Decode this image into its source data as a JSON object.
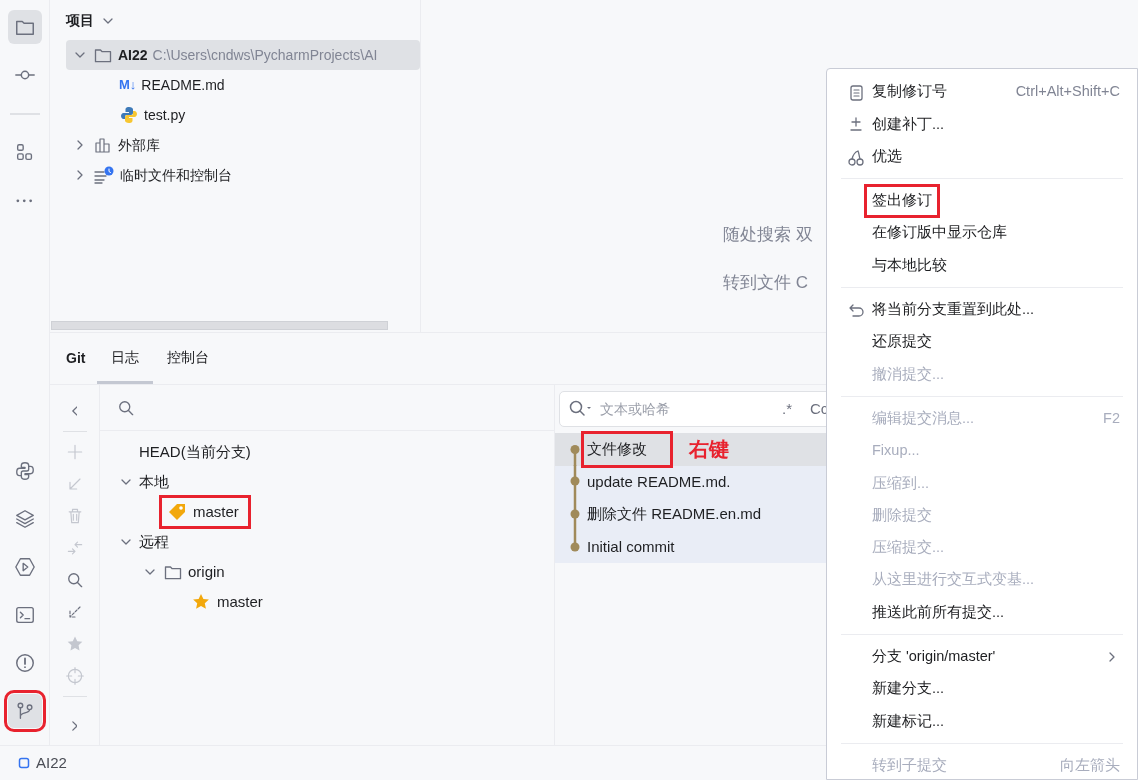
{
  "tool_window_bar": {
    "top": [
      {
        "kind": "folder",
        "selected": true
      },
      {
        "kind": "commit",
        "selected": false
      },
      {
        "kind": "separator"
      },
      {
        "kind": "structure",
        "selected": false
      },
      {
        "kind": "more",
        "selected": false
      }
    ],
    "bottom": [
      {
        "kind": "python",
        "selected": false
      },
      {
        "kind": "layers",
        "selected": false
      },
      {
        "kind": "run",
        "selected": false
      },
      {
        "kind": "terminal",
        "selected": false
      },
      {
        "kind": "problems",
        "selected": false
      },
      {
        "kind": "git",
        "selected": true,
        "annotated": true
      }
    ]
  },
  "project": {
    "title": "项目",
    "tree": [
      {
        "kind": "project",
        "label": "AI22",
        "path": "C:\\Users\\cndws\\PycharmProjects\\AI",
        "expanded": true,
        "selected": true,
        "children": [
          {
            "kind": "markdown",
            "icon_text": "M↓",
            "label": "README.md",
            "selected": false
          },
          {
            "kind": "python",
            "label": "test.py",
            "selected": false
          }
        ]
      },
      {
        "kind": "library",
        "label": "外部库",
        "expanded": false,
        "selected": false
      },
      {
        "kind": "scratches",
        "label": "临时文件和控制台",
        "expanded": false,
        "selected": false
      }
    ]
  },
  "editor": {
    "hints": [
      "随处搜索 双",
      "转到文件 C"
    ]
  },
  "git": {
    "title": "Git",
    "tabs": [
      {
        "label": "日志",
        "selected": true
      },
      {
        "label": "控制台",
        "selected": false
      }
    ],
    "toolbar": [
      {
        "kind": "collapse",
        "disabled": false
      },
      {
        "kind": "separator"
      },
      {
        "kind": "add",
        "disabled": true
      },
      {
        "kind": "checkout",
        "disabled": true
      },
      {
        "kind": "delete",
        "disabled": true
      },
      {
        "kind": "merge",
        "disabled": true
      },
      {
        "kind": "search",
        "disabled": false
      },
      {
        "kind": "fetch",
        "disabled": false
      },
      {
        "kind": "favorite",
        "disabled": true
      },
      {
        "kind": "locate",
        "disabled": true
      },
      {
        "kind": "separator"
      },
      {
        "kind": "expand",
        "disabled": false
      }
    ],
    "branches": [
      {
        "label": "HEAD(当前分支)"
      },
      {
        "label": "本地",
        "expanded": true,
        "children": [
          {
            "kind": "local_branch",
            "label": "master",
            "annotated": true
          }
        ]
      },
      {
        "label": "远程",
        "expanded": true,
        "children": [
          {
            "kind": "remote",
            "label": "origin",
            "expanded": true,
            "children": [
              {
                "kind": "remote_branch",
                "label": "master",
                "annotated": false
              }
            ]
          }
        ]
      }
    ],
    "log": {
      "search": {
        "placeholder": "文本或哈希",
        "regex": ".*",
        "case": "Cc"
      },
      "annotation_label": "右键",
      "commits": [
        {
          "message": "文件修改",
          "selected": true,
          "annotated": true
        },
        {
          "message": "update README.md.",
          "selected": false,
          "annotated": false
        },
        {
          "message": "删除文件 README.en.md",
          "selected": false,
          "annotated": false
        },
        {
          "message": "Initial commit",
          "selected": false,
          "annotated": false
        }
      ]
    }
  },
  "context_menu": {
    "items": [
      {
        "kind": "copy",
        "label": "复制修订号",
        "shortcut": "Ctrl+Alt+Shift+C",
        "disabled": false
      },
      {
        "kind": "patch",
        "label": "创建补丁...",
        "disabled": false
      },
      {
        "kind": "cherry",
        "label": "优选",
        "disabled": false
      },
      {
        "kind": "separator"
      },
      {
        "kind": "item",
        "label": "签出修订",
        "disabled": false,
        "annotated": true
      },
      {
        "kind": "item",
        "label": "在修订版中显示仓库",
        "disabled": false
      },
      {
        "kind": "item",
        "label": "与本地比较",
        "disabled": false
      },
      {
        "kind": "separator"
      },
      {
        "kind": "undo",
        "label": "将当前分支重置到此处...",
        "disabled": false
      },
      {
        "kind": "item",
        "label": "还原提交",
        "disabled": false
      },
      {
        "kind": "item",
        "label": "撤消提交...",
        "disabled": true
      },
      {
        "kind": "separator"
      },
      {
        "kind": "item",
        "label": "编辑提交消息...",
        "shortcut": "F2",
        "disabled": true
      },
      {
        "kind": "item",
        "label": "Fixup...",
        "disabled": true
      },
      {
        "kind": "item",
        "label": "压缩到...",
        "disabled": true
      },
      {
        "kind": "item",
        "label": "删除提交",
        "disabled": true
      },
      {
        "kind": "item",
        "label": "压缩提交...",
        "disabled": true
      },
      {
        "kind": "item",
        "label": "从这里进行交互式变基...",
        "disabled": true
      },
      {
        "kind": "item",
        "label": "推送此前所有提交...",
        "disabled": false
      },
      {
        "kind": "separator"
      },
      {
        "kind": "item",
        "label": "分支 'origin/master'",
        "disabled": false,
        "submenu": true
      },
      {
        "kind": "item",
        "label": "新建分支...",
        "disabled": false
      },
      {
        "kind": "item",
        "label": "新建标记...",
        "disabled": false
      },
      {
        "kind": "separator"
      },
      {
        "kind": "item",
        "label": "转到子提交",
        "shortcut": "向左箭头",
        "disabled": true
      }
    ]
  },
  "status_bar": {
    "project": "AI22"
  }
}
